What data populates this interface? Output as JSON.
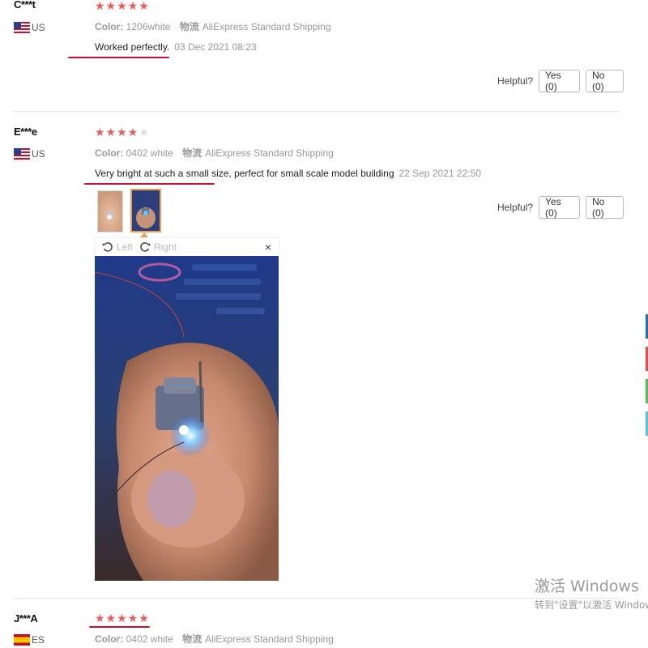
{
  "reviews": [
    {
      "name": "C***t",
      "country": "US",
      "stars": "★★★★★",
      "stars_empty": "",
      "color_label": "Color:",
      "color_value": "1206white",
      "shipping_label": "物流",
      "shipping_value": "AliExpress Standard Shipping",
      "text": "Worked perfectly.",
      "date": "03 Dec 2021 08:23",
      "helpful_label": "Helpful?",
      "yes_label": "Yes (0)",
      "no_label": "No (0)"
    },
    {
      "name": "E***e",
      "country": "US",
      "stars": "★★★★",
      "stars_empty": "★",
      "color_label": "Color:",
      "color_value": "0402 white",
      "shipping_label": "物流",
      "shipping_value": "AliExpress Standard Shipping",
      "text": "Very bright at such a small size, perfect for small scale model building",
      "date": "22 Sep 2021 22:50",
      "helpful_label": "Helpful?",
      "yes_label": "Yes (0)",
      "no_label": "No (0)"
    },
    {
      "name": "J***A",
      "country": "ES",
      "stars": "★★★★★",
      "stars_empty": "",
      "color_label": "Color:",
      "color_value": "0402 white",
      "shipping_label": "物流",
      "shipping_value": "AliExpress Standard Shipping"
    }
  ],
  "viewer": {
    "left_label": "Left",
    "right_label": "Right",
    "close_label": "×"
  },
  "watermark": {
    "line1": "激活 Windows",
    "line2": "转到\"设置\"以激活 Windows"
  },
  "colors": {
    "star": "#e95b5b",
    "underline": "#c8102e",
    "thumb_selected": "#f29b54"
  }
}
